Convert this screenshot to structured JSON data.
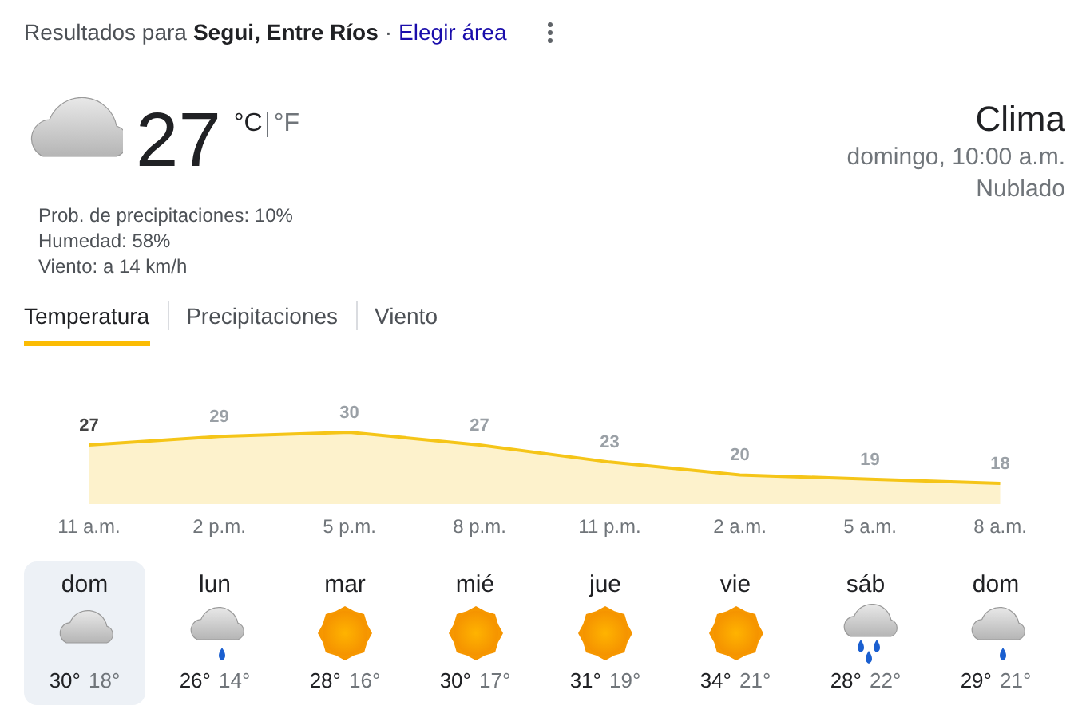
{
  "header": {
    "prefix": "Resultados para",
    "location": "Segui, Entre Ríos",
    "separator": "·",
    "link": "Elegir área"
  },
  "current": {
    "kind": "cloudy",
    "temperature": "27",
    "units": [
      {
        "label": "°C",
        "selected": true
      },
      {
        "label": "°F",
        "selected": false
      }
    ],
    "details": [
      "Prob. de precipitaciones: 10%",
      "Humedad: 58%",
      "Viento: a 14 km/h"
    ],
    "title": "Clima",
    "time": "domingo, 10:00 a.m.",
    "condition": "Nublado"
  },
  "tabs": [
    {
      "label": "Temperatura",
      "selected": true
    },
    {
      "label": "Precipitaciones",
      "selected": false
    },
    {
      "label": "Viento",
      "selected": false
    }
  ],
  "chart_data": {
    "type": "area",
    "categories": [
      "11 a.m.",
      "2 p.m.",
      "5 p.m.",
      "8 p.m.",
      "11 p.m.",
      "2 a.m.",
      "5 a.m.",
      "8 a.m."
    ],
    "data_labels": true,
    "series": [
      {
        "color": "#f5c518",
        "values": [
          27,
          29,
          30,
          27,
          23,
          20,
          19,
          18
        ]
      }
    ]
  },
  "days": [
    {
      "day": "dom",
      "kind": "cloudy",
      "high": "30°",
      "low": "18°",
      "selected": true
    },
    {
      "day": "lun",
      "kind": "rain",
      "high": "26°",
      "low": "14°",
      "selected": false
    },
    {
      "day": "mar",
      "kind": "sunny",
      "high": "28°",
      "low": "16°",
      "selected": false
    },
    {
      "day": "mié",
      "kind": "sunny",
      "high": "30°",
      "low": "17°",
      "selected": false
    },
    {
      "day": "jue",
      "kind": "sunny",
      "high": "31°",
      "low": "19°",
      "selected": false
    },
    {
      "day": "vie",
      "kind": "sunny",
      "high": "34°",
      "low": "21°",
      "selected": false
    },
    {
      "day": "sáb",
      "kind": "showers",
      "high": "28°",
      "low": "22°",
      "selected": false
    },
    {
      "day": "dom",
      "kind": "rain",
      "high": "29°",
      "low": "21°",
      "selected": false
    }
  ]
}
